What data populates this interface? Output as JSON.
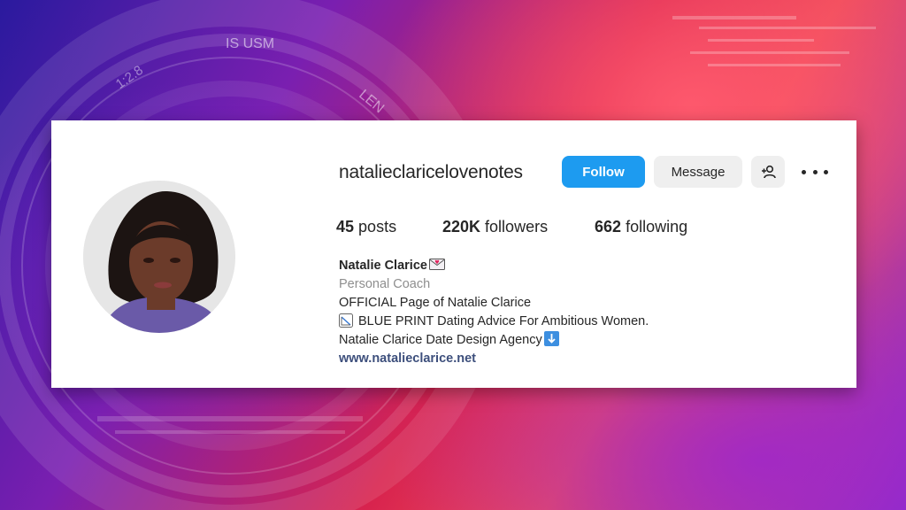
{
  "background": {
    "lens_texts": [
      "IS USM",
      "1:2.8",
      "LEN"
    ]
  },
  "profile": {
    "username": "natalieclaricelovenotes",
    "buttons": {
      "follow": "Follow",
      "message": "Message"
    },
    "stats": {
      "posts_count": "45",
      "posts_label": "posts",
      "followers_count": "220K",
      "followers_label": "followers",
      "following_count": "662",
      "following_label": "following"
    },
    "bio": {
      "name": "Natalie Clarice",
      "category": "Personal Coach",
      "line1": "OFFICIAL Page of Natalie Clarice",
      "line2": "BLUE PRINT Dating Advice For Ambitious Women.",
      "line3": "Natalie Clarice Date Design Agency",
      "website": "www.natalieclarice.net"
    }
  },
  "icons": {
    "name_emoji": "love-letter-icon",
    "line2_emoji": "chart-icon",
    "line3_emoji": "down-arrow-icon",
    "add_user": "add-user-icon",
    "more": "more-options-icon"
  },
  "colors": {
    "follow_button": "#1d9bf0",
    "secondary_button": "#efefef",
    "link": "#3d4f7c",
    "category": "#8e8e8e"
  }
}
